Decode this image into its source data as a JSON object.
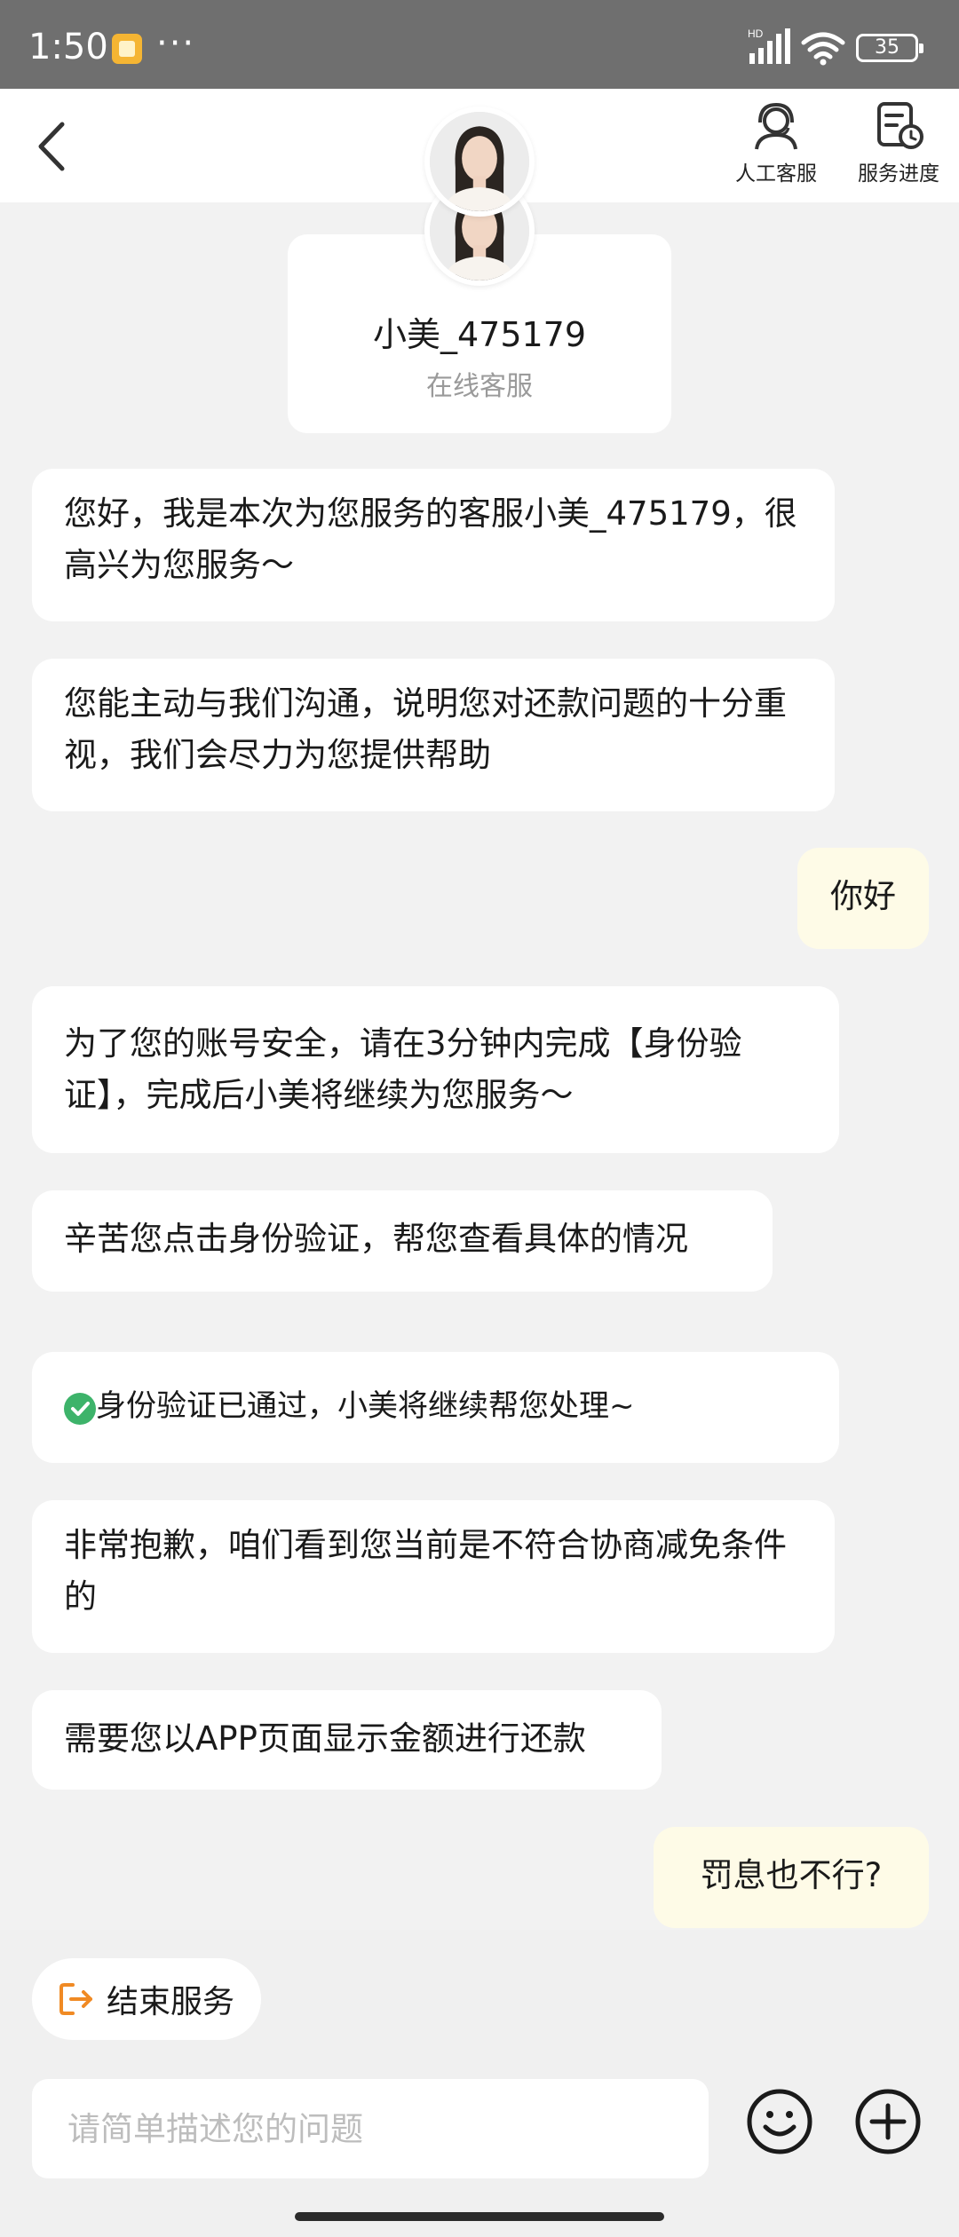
{
  "status_bar": {
    "time": "1:50",
    "more": "···",
    "network_label": "HD",
    "battery": "35"
  },
  "header": {
    "back_icon": "chevron-left-icon",
    "support_label": "人工客服",
    "progress_label": "服务进度"
  },
  "agent": {
    "name": "小美_475179",
    "role": "在线客服"
  },
  "messages": [
    {
      "from": "agent",
      "text": "您好，我是本次为您服务的客服小美_475179，很高兴为您服务～"
    },
    {
      "from": "agent",
      "text": "您能主动与我们沟通，说明您对还款问题的十分重视，我们会尽力为您提供帮助"
    },
    {
      "from": "user",
      "text": "你好"
    },
    {
      "from": "agent",
      "text": "为了您的账号安全，请在3分钟内完成【身份验证】，完成后小美将继续为您服务～"
    },
    {
      "from": "agent",
      "text": "辛苦您点击身份验证，帮您查看具体的情况"
    },
    {
      "from": "agent",
      "text": "身份验证已通过，小美将继续帮您处理~",
      "icon": "check-circle-icon"
    },
    {
      "from": "agent",
      "text": "非常抱歉，咱们看到您当前是不符合协商减免条件的"
    },
    {
      "from": "agent",
      "text": "需要您以APP页面显示金额进行还款"
    },
    {
      "from": "user",
      "text": "罚息也不行?"
    }
  ],
  "bottom": {
    "end_service_label": "结束服务",
    "input_placeholder": "请简单描述您的问题",
    "emoji_icon": "smiley-icon",
    "plus_icon": "plus-circle-icon"
  },
  "colors": {
    "page_bg": "#f2f2f2",
    "user_bubble": "#fefbe7",
    "status_bar": "#6f6f6f",
    "check_green": "#3db36a",
    "end_service_icon": "#f08a24"
  }
}
